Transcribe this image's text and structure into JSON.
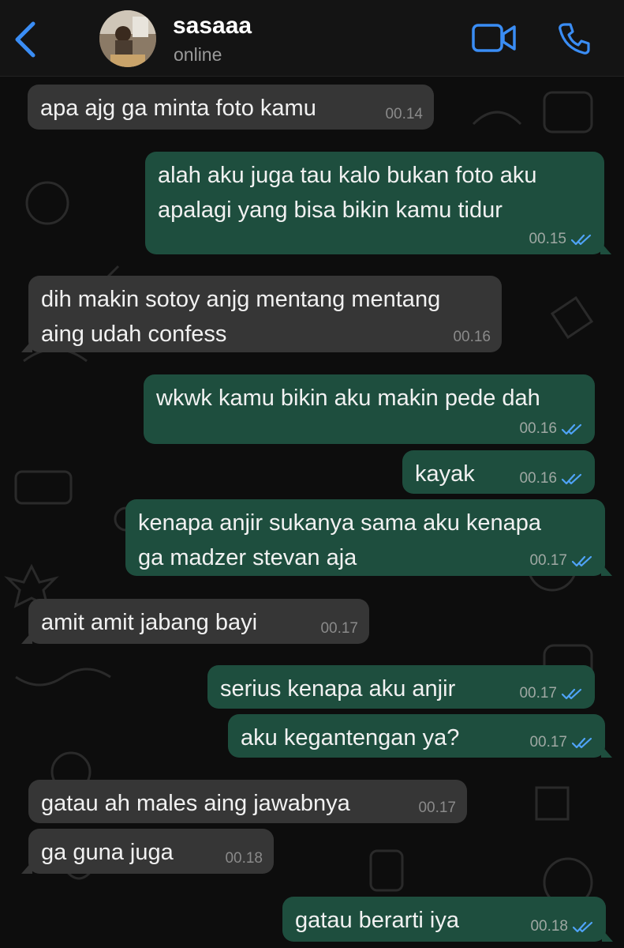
{
  "header": {
    "contact_name": "sasaaa",
    "status": "online"
  },
  "colors": {
    "accent": "#3a8df5",
    "incoming_bubble": "#363636",
    "outgoing_bubble": "#1e4e3e",
    "read_tick": "#4fa3f7"
  },
  "icons": [
    "back-chevron-icon",
    "video-call-icon",
    "phone-icon",
    "double-check-icon"
  ],
  "messages": [
    {
      "direction": "in",
      "text": "apa ajg ga minta foto kamu",
      "time": "00.14"
    },
    {
      "direction": "out",
      "text": "alah aku juga tau kalo bukan foto aku\napalagi yang bisa bikin kamu tidur",
      "time": "00.15",
      "read": true
    },
    {
      "direction": "in",
      "text": "dih makin sotoy anjg mentang mentang\naing udah confess",
      "time": "00.16"
    },
    {
      "direction": "out",
      "text": "wkwk kamu bikin aku makin pede dah",
      "time": "00.16",
      "read": true
    },
    {
      "direction": "out",
      "text": "kayak",
      "time": "00.16",
      "read": true
    },
    {
      "direction": "out",
      "text": "kenapa anjir sukanya sama aku kenapa\nga madzer stevan aja",
      "time": "00.17",
      "read": true
    },
    {
      "direction": "in",
      "text": "amit amit jabang bayi",
      "time": "00.17"
    },
    {
      "direction": "out",
      "text": "serius kenapa aku anjir",
      "time": "00.17",
      "read": true
    },
    {
      "direction": "out",
      "text": "aku kegantengan ya?",
      "time": "00.17",
      "read": true
    },
    {
      "direction": "in",
      "text": "gatau ah males aing jawabnya",
      "time": "00.17"
    },
    {
      "direction": "in",
      "text": "ga guna juga",
      "time": "00.18"
    },
    {
      "direction": "out",
      "text": "gatau berarti iya",
      "time": "00.18",
      "read": true
    }
  ]
}
